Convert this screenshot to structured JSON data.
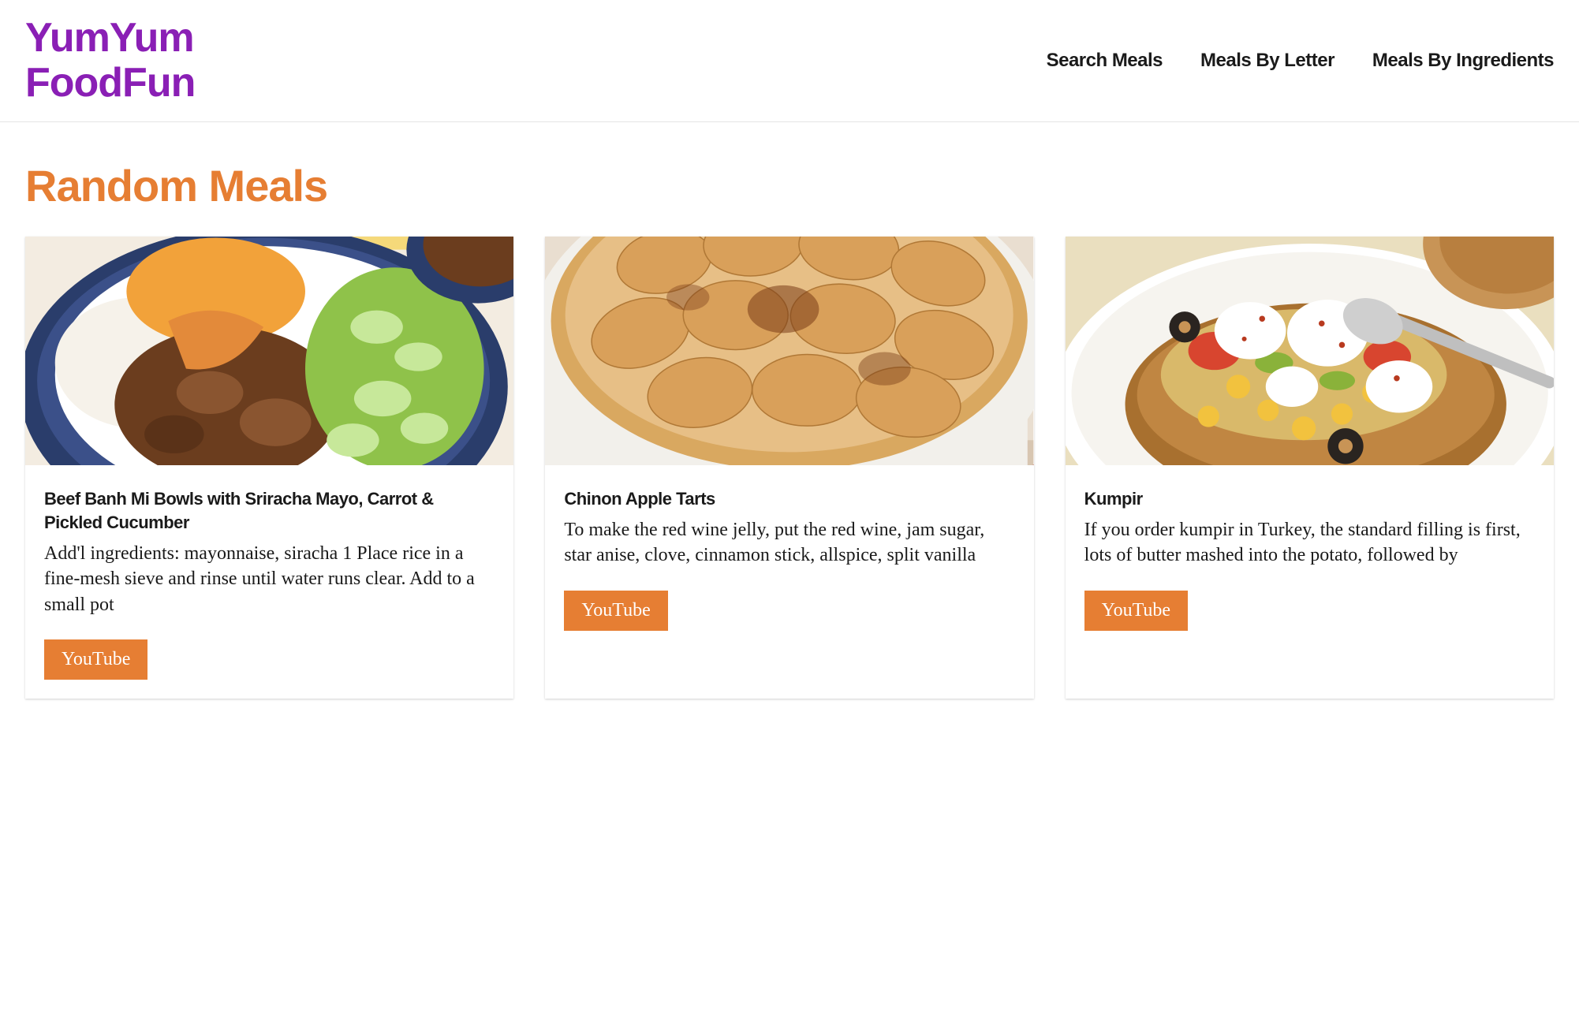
{
  "header": {
    "logo_line1": "YumYum",
    "logo_line2": "FoodFun",
    "nav": [
      {
        "label": "Search Meals"
      },
      {
        "label": "Meals By Letter"
      },
      {
        "label": "Meals By Ingredients"
      }
    ]
  },
  "page_title": "Random Meals",
  "youtube_label": "YouTube",
  "meals": [
    {
      "title": "Beef Banh Mi Bowls with Sriracha Mayo, Carrot & Pickled Cucumber",
      "description": "Add'l ingredients: mayonnaise, siracha 1 Place rice in a fine-mesh sieve and rinse until water runs clear. Add to a small pot"
    },
    {
      "title": "Chinon Apple Tarts",
      "description": "To make the red wine jelly, put the red wine, jam sugar, star anise, clove, cinnamon stick, allspice, split vanilla"
    },
    {
      "title": "Kumpir",
      "description": "If you order kumpir in Turkey, the standard filling is first, lots of butter mashed into the potato, followed by"
    }
  ]
}
